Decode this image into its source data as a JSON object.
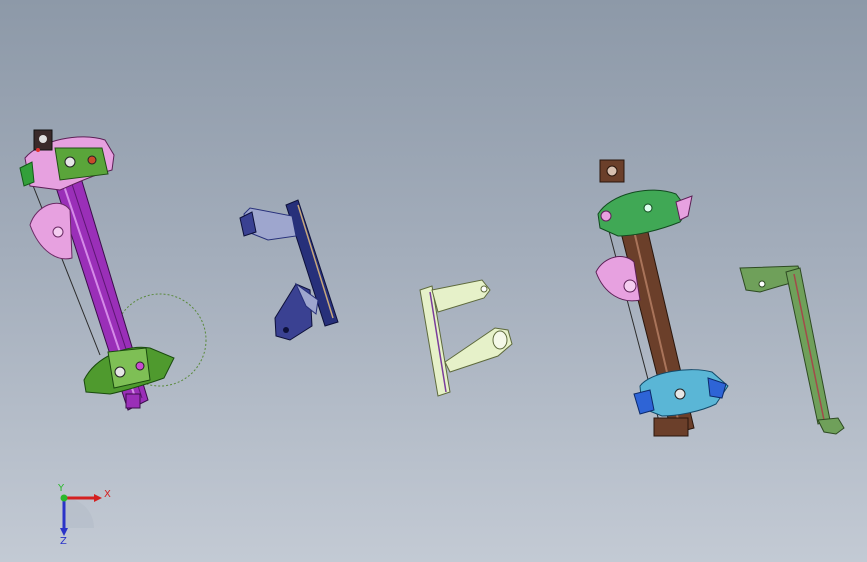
{
  "viewport": {
    "background_top": "#8d99a8",
    "background_bottom": "#c3cad4"
  },
  "parts": [
    {
      "name": "window-regulator-left",
      "colors": [
        "#9a2fb8",
        "#4f9a2e",
        "#e7a1e0",
        "#33a03a"
      ]
    },
    {
      "name": "bracket-blue",
      "colors": [
        "#27307a",
        "#9ea6ce",
        "#3a4192"
      ]
    },
    {
      "name": "bracket-pale-green",
      "colors": [
        "#e6f1c9",
        "#7a3c9c"
      ]
    },
    {
      "name": "window-regulator-right",
      "colors": [
        "#6b3f2a",
        "#40a855",
        "#5ab6d6",
        "#2e64d6",
        "#e7a1e0"
      ]
    },
    {
      "name": "rail-olive-green",
      "colors": [
        "#6fa05a",
        "#a34a4a"
      ]
    }
  ],
  "triad": {
    "x_label": "X",
    "y_label": "Y",
    "z_label": "Z",
    "x_color": "#d42020",
    "y_color": "#2bb82b",
    "z_color": "#2a33c8"
  }
}
